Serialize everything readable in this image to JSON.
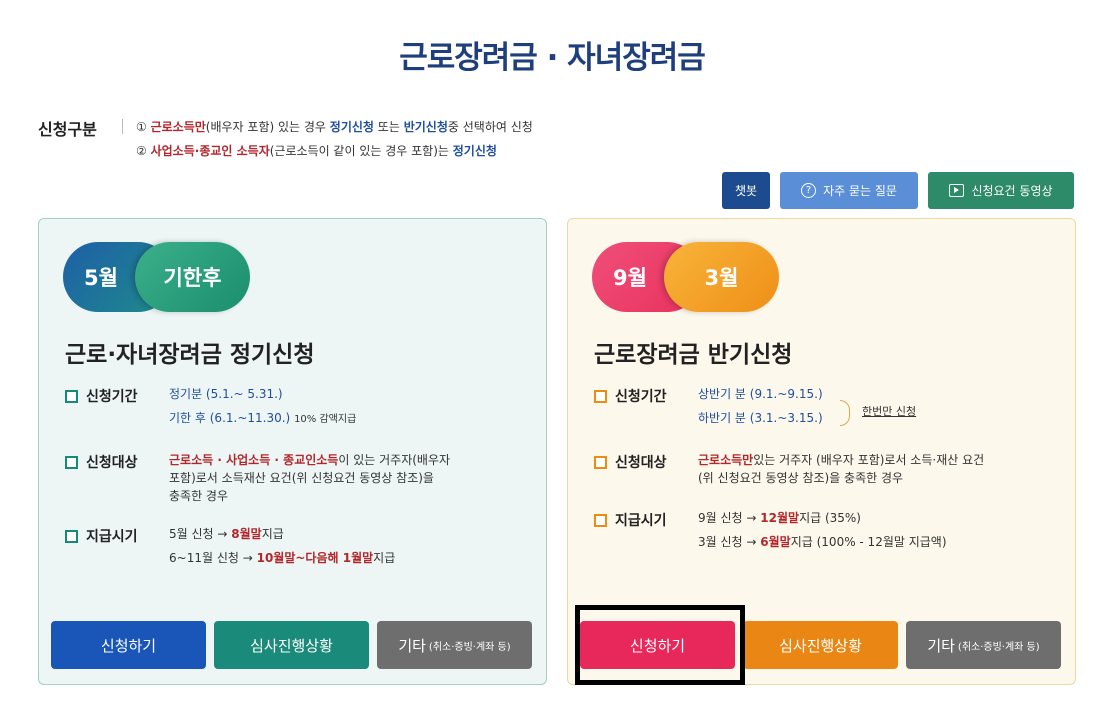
{
  "page": {
    "title": "근로장려금 · 자녀장려금"
  },
  "apply_type": {
    "label": "신청구분",
    "line1": {
      "num": "①",
      "red": "근로소득만",
      "mid": "(배우자 포함) 있는 경우",
      "blue1": "정기신청",
      "conj": "또는",
      "blue2": "반기신청",
      "end": "중 선택하여 신청"
    },
    "line2": {
      "num": "②",
      "red": "사업소득·종교인 소득자",
      "mid": "(근로소득이 같이 있는 경우 포함)는",
      "blue": "정기신청"
    }
  },
  "top_buttons": {
    "chatbot": "챗봇",
    "faq": "자주 묻는 질문",
    "video": "신청요건 동영상"
  },
  "left_panel": {
    "pill_a": "5월",
    "pill_b": "기한후",
    "title": "근로·자녀장려금 정기신청",
    "period": {
      "label": "신청기간",
      "line1": "정기분 (5.1.~ 5.31.)",
      "line2": "기한 후 (6.1.~11.30.)",
      "line2_note": "10% 감액지급"
    },
    "target": {
      "label": "신청대상",
      "red": "근로소득 · 사업소득 · 종교인소득",
      "line1_end": "이 있는 거주자(배우자",
      "line2": "포함)로서 소득재산 요건(위 신청요건 동영상 참조)을",
      "line3": "충족한 경우"
    },
    "payment": {
      "label": "지급시기",
      "l1_a": "5월 신청 →",
      "l1_red": "8월말",
      "l1_b": "지급",
      "l2_a": "6~11월 신청 →",
      "l2_red": "10월말~다음해 1월말",
      "l2_b": "지급"
    },
    "buttons": {
      "apply": "신청하기",
      "status": "심사진행상황",
      "other": "기타",
      "other_note": "(취소·증빙·계좌 등)"
    }
  },
  "right_panel": {
    "pill_a": "9월",
    "pill_b": "3월",
    "title": "근로장려금 반기신청",
    "period": {
      "label": "신청기간",
      "line1": "상반기 분 (9.1.~9.15.)",
      "line2": "하반기 분 (3.1.~3.15.)",
      "note": "한번만 신청"
    },
    "target": {
      "label": "신청대상",
      "red": "근로소득만",
      "line1_end": "있는 거주자 (배우자 포함)로서 소득·재산 요건",
      "line2": "(위 신청요건 동영상 참조)을 충족한 경우"
    },
    "payment": {
      "label": "지급시기",
      "l1_a": "9월 신청 →",
      "l1_red": "12월말",
      "l1_b": "지급 (35%)",
      "l2_a": "3월 신청 →",
      "l2_red": "6월말",
      "l2_b": "지급 (100% - 12월말 지급액)"
    },
    "buttons": {
      "apply": "신청하기",
      "status": "심사진행상황",
      "other": "기타",
      "other_note": "(취소·증빙·계좌 등)"
    }
  },
  "colors": {
    "title_navy": "#1f3e7c",
    "left_panel_bg": "#edf6f5",
    "right_panel_bg": "#fdf8ec",
    "apply_blue": "#1a56b8",
    "apply_pink": "#e8285a",
    "status_teal": "#1a8a7a",
    "status_orange": "#ea8614",
    "other_grey": "#6e6e6e",
    "highlight_border": "#000000"
  }
}
